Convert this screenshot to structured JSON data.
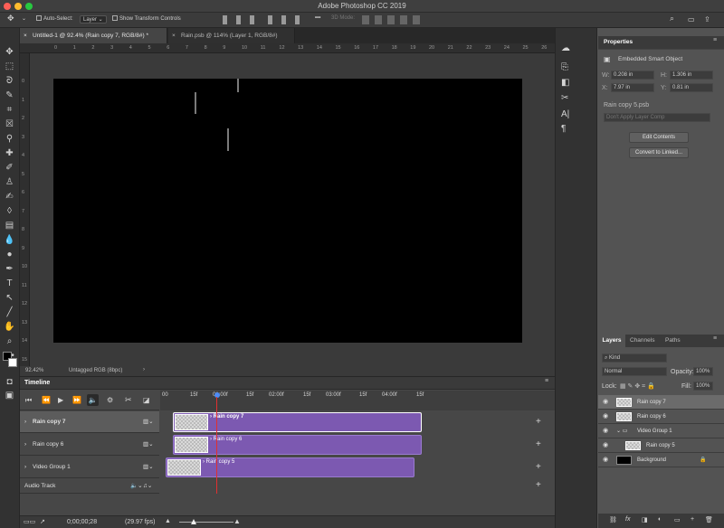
{
  "app": {
    "title": "Adobe Photoshop CC 2019"
  },
  "options": {
    "auto_select": "Auto-Select:",
    "auto_select_value": "Layer",
    "show_transform": "Show Transform Controls",
    "mode3d": "3D Mode:",
    "more": "•••"
  },
  "tabs": [
    {
      "label": "Untitled-1 @ 92.4% (Rain copy 7, RGB/8#) *",
      "close": "×"
    },
    {
      "label": "Rain.psb @ 114% (Layer 1, RGB/8#)",
      "close": "×"
    }
  ],
  "ruler_h": [
    "0",
    "1",
    "2",
    "3",
    "4",
    "5",
    "6",
    "7",
    "8",
    "9",
    "10",
    "11",
    "12",
    "13",
    "14",
    "15",
    "16",
    "17",
    "18",
    "19",
    "20",
    "21",
    "22",
    "23",
    "24",
    "25",
    "26"
  ],
  "ruler_v": [
    "0",
    "1",
    "2",
    "3",
    "4",
    "5",
    "6",
    "7",
    "8",
    "9",
    "10",
    "11",
    "12",
    "13",
    "14",
    "15"
  ],
  "status": {
    "zoom": "92.42%",
    "profile": "Untagged RGB (8bpc)",
    "arrow": "›"
  },
  "timeline": {
    "title": "Timeline",
    "ticks": [
      "00",
      "15f",
      "01:00f",
      "15f",
      "02:00f",
      "15f",
      "03:00f",
      "15f",
      "04:00f",
      "15f"
    ],
    "tracks": [
      {
        "name": "Rain copy 7",
        "clip": "Rain copy 7"
      },
      {
        "name": "Rain copy 6",
        "clip": "Rain copy 6"
      },
      {
        "name": "Video Group 1",
        "clip": "Rain copy 5"
      }
    ],
    "audio": "Audio Track",
    "timecode": "0;00;00;28",
    "fps": "(29.97 fps)",
    "add": "+"
  },
  "properties": {
    "tabs": [
      "Properties"
    ],
    "type": "Embedded Smart Object",
    "w_label": "W:",
    "w": "0.208 in",
    "h_label": "H:",
    "h": "1.306 in",
    "x_label": "X:",
    "x": "7.97 in",
    "y_label": "Y:",
    "y": "0.81 in",
    "file": "Rain copy 5.psb",
    "comp_placeholder": "Don't Apply Layer Comp",
    "edit_button": "Edit Contents",
    "convert_button": "Convert to Linked..."
  },
  "layers": {
    "tabs": [
      "Layers",
      "Channels",
      "Paths"
    ],
    "filter": "Kind",
    "blend": "Normal",
    "opacity_label": "Opacity:",
    "opacity": "100%",
    "lock_label": "Lock:",
    "fill_label": "Fill:",
    "fill": "100%",
    "items": [
      {
        "name": "Rain copy 7"
      },
      {
        "name": "Rain copy 6"
      },
      {
        "name": "Video Group 1"
      },
      {
        "name": "Rain copy 5"
      },
      {
        "name": "Background"
      }
    ],
    "footer": [
      "⛓",
      "fx",
      "◨",
      "◐",
      "▭",
      "+",
      "🗑"
    ]
  }
}
